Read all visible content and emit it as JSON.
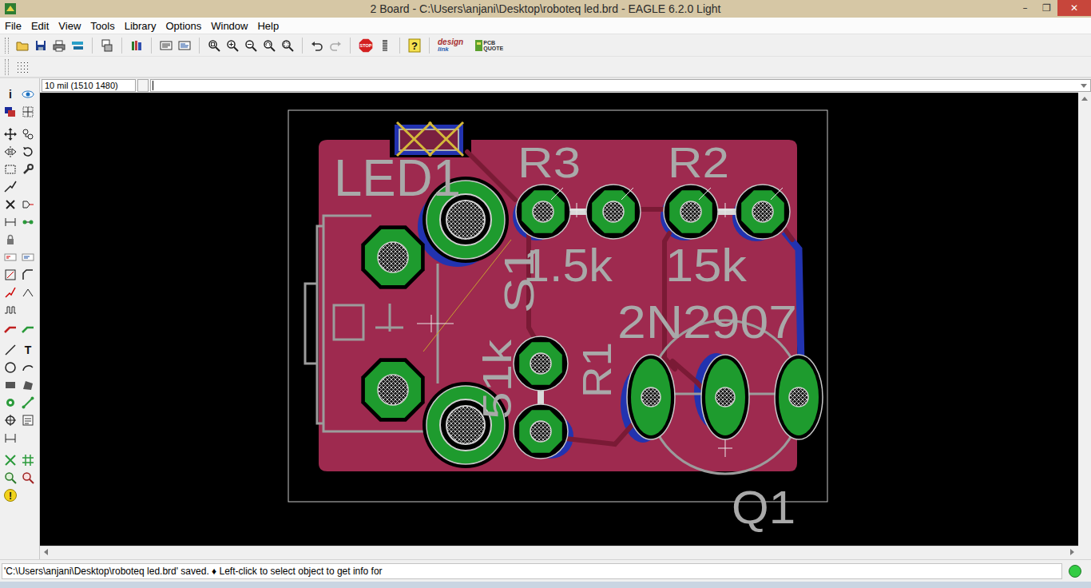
{
  "window": {
    "title": "2 Board - C:\\Users\\anjani\\Desktop\\roboteq led.brd - EAGLE 6.2.0 Light",
    "controls": [
      "–",
      "❐",
      "✕"
    ]
  },
  "menu": [
    "File",
    "Edit",
    "View",
    "Tools",
    "Library",
    "Options",
    "Window",
    "Help"
  ],
  "toolbar": {
    "stop": "STOP",
    "help": "?",
    "design_link": [
      "design",
      "link"
    ],
    "pcb_quote": [
      "PCB",
      "QUOTE"
    ]
  },
  "tool_glyphs": {
    "info": "i",
    "text": "T",
    "errors": "!"
  },
  "command": {
    "coordinates": "10 mil (1510 1480)",
    "value": ""
  },
  "board": {
    "parts": [
      {
        "name": "LED1"
      },
      {
        "name": "R3",
        "value": "1.5k"
      },
      {
        "name": "R2",
        "value": "15k"
      },
      {
        "name": "Q1",
        "value": "2N2907"
      },
      {
        "name": "S1"
      },
      {
        "name": "R1",
        "value": "51k"
      }
    ]
  },
  "status_bar": {
    "message": "'C:\\Users\\anjani\\Desktop\\roboteq led.brd' saved. ♦ Left-click to select object to get info for",
    "ready": true
  }
}
